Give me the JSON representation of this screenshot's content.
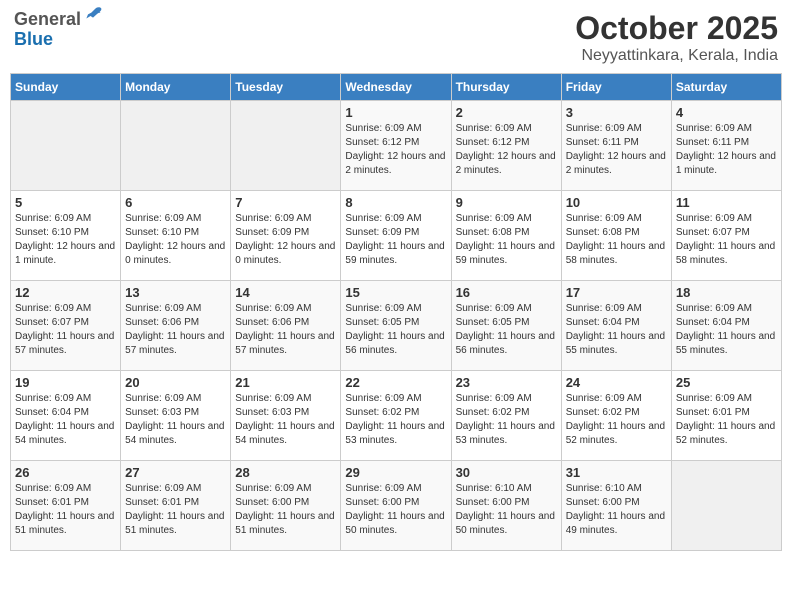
{
  "header": {
    "logo_line1": "General",
    "logo_line2": "Blue",
    "month": "October 2025",
    "location": "Neyyattinkara, Kerala, India"
  },
  "weekdays": [
    "Sunday",
    "Monday",
    "Tuesday",
    "Wednesday",
    "Thursday",
    "Friday",
    "Saturday"
  ],
  "weeks": [
    [
      {
        "day": "",
        "info": ""
      },
      {
        "day": "",
        "info": ""
      },
      {
        "day": "",
        "info": ""
      },
      {
        "day": "1",
        "info": "Sunrise: 6:09 AM\nSunset: 6:12 PM\nDaylight: 12 hours and 2 minutes."
      },
      {
        "day": "2",
        "info": "Sunrise: 6:09 AM\nSunset: 6:12 PM\nDaylight: 12 hours and 2 minutes."
      },
      {
        "day": "3",
        "info": "Sunrise: 6:09 AM\nSunset: 6:11 PM\nDaylight: 12 hours and 2 minutes."
      },
      {
        "day": "4",
        "info": "Sunrise: 6:09 AM\nSunset: 6:11 PM\nDaylight: 12 hours and 1 minute."
      }
    ],
    [
      {
        "day": "5",
        "info": "Sunrise: 6:09 AM\nSunset: 6:10 PM\nDaylight: 12 hours and 1 minute."
      },
      {
        "day": "6",
        "info": "Sunrise: 6:09 AM\nSunset: 6:10 PM\nDaylight: 12 hours and 0 minutes."
      },
      {
        "day": "7",
        "info": "Sunrise: 6:09 AM\nSunset: 6:09 PM\nDaylight: 12 hours and 0 minutes."
      },
      {
        "day": "8",
        "info": "Sunrise: 6:09 AM\nSunset: 6:09 PM\nDaylight: 11 hours and 59 minutes."
      },
      {
        "day": "9",
        "info": "Sunrise: 6:09 AM\nSunset: 6:08 PM\nDaylight: 11 hours and 59 minutes."
      },
      {
        "day": "10",
        "info": "Sunrise: 6:09 AM\nSunset: 6:08 PM\nDaylight: 11 hours and 58 minutes."
      },
      {
        "day": "11",
        "info": "Sunrise: 6:09 AM\nSunset: 6:07 PM\nDaylight: 11 hours and 58 minutes."
      }
    ],
    [
      {
        "day": "12",
        "info": "Sunrise: 6:09 AM\nSunset: 6:07 PM\nDaylight: 11 hours and 57 minutes."
      },
      {
        "day": "13",
        "info": "Sunrise: 6:09 AM\nSunset: 6:06 PM\nDaylight: 11 hours and 57 minutes."
      },
      {
        "day": "14",
        "info": "Sunrise: 6:09 AM\nSunset: 6:06 PM\nDaylight: 11 hours and 57 minutes."
      },
      {
        "day": "15",
        "info": "Sunrise: 6:09 AM\nSunset: 6:05 PM\nDaylight: 11 hours and 56 minutes."
      },
      {
        "day": "16",
        "info": "Sunrise: 6:09 AM\nSunset: 6:05 PM\nDaylight: 11 hours and 56 minutes."
      },
      {
        "day": "17",
        "info": "Sunrise: 6:09 AM\nSunset: 6:04 PM\nDaylight: 11 hours and 55 minutes."
      },
      {
        "day": "18",
        "info": "Sunrise: 6:09 AM\nSunset: 6:04 PM\nDaylight: 11 hours and 55 minutes."
      }
    ],
    [
      {
        "day": "19",
        "info": "Sunrise: 6:09 AM\nSunset: 6:04 PM\nDaylight: 11 hours and 54 minutes."
      },
      {
        "day": "20",
        "info": "Sunrise: 6:09 AM\nSunset: 6:03 PM\nDaylight: 11 hours and 54 minutes."
      },
      {
        "day": "21",
        "info": "Sunrise: 6:09 AM\nSunset: 6:03 PM\nDaylight: 11 hours and 54 minutes."
      },
      {
        "day": "22",
        "info": "Sunrise: 6:09 AM\nSunset: 6:02 PM\nDaylight: 11 hours and 53 minutes."
      },
      {
        "day": "23",
        "info": "Sunrise: 6:09 AM\nSunset: 6:02 PM\nDaylight: 11 hours and 53 minutes."
      },
      {
        "day": "24",
        "info": "Sunrise: 6:09 AM\nSunset: 6:02 PM\nDaylight: 11 hours and 52 minutes."
      },
      {
        "day": "25",
        "info": "Sunrise: 6:09 AM\nSunset: 6:01 PM\nDaylight: 11 hours and 52 minutes."
      }
    ],
    [
      {
        "day": "26",
        "info": "Sunrise: 6:09 AM\nSunset: 6:01 PM\nDaylight: 11 hours and 51 minutes."
      },
      {
        "day": "27",
        "info": "Sunrise: 6:09 AM\nSunset: 6:01 PM\nDaylight: 11 hours and 51 minutes."
      },
      {
        "day": "28",
        "info": "Sunrise: 6:09 AM\nSunset: 6:00 PM\nDaylight: 11 hours and 51 minutes."
      },
      {
        "day": "29",
        "info": "Sunrise: 6:09 AM\nSunset: 6:00 PM\nDaylight: 11 hours and 50 minutes."
      },
      {
        "day": "30",
        "info": "Sunrise: 6:10 AM\nSunset: 6:00 PM\nDaylight: 11 hours and 50 minutes."
      },
      {
        "day": "31",
        "info": "Sunrise: 6:10 AM\nSunset: 6:00 PM\nDaylight: 11 hours and 49 minutes."
      },
      {
        "day": "",
        "info": ""
      }
    ]
  ]
}
